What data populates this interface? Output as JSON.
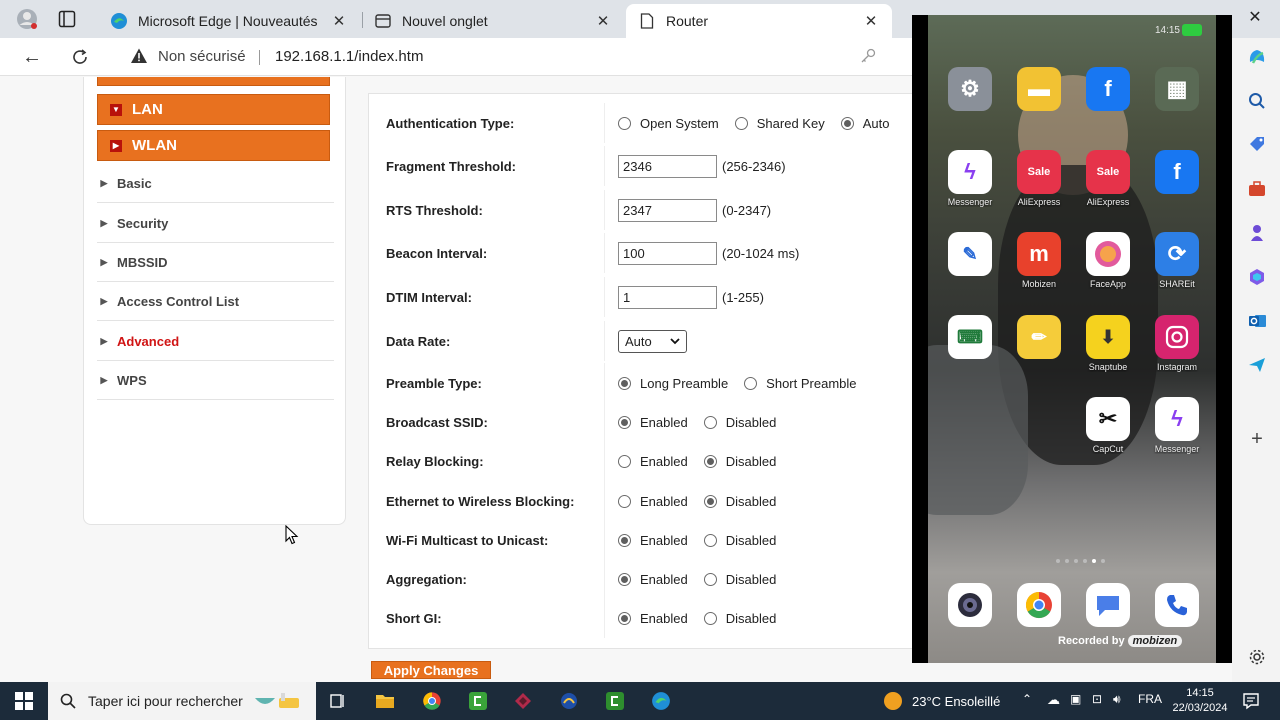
{
  "browser": {
    "tabs": [
      {
        "label": "Microsoft Edge | Nouveautés",
        "active": false
      },
      {
        "label": "Nouvel onglet",
        "active": false
      },
      {
        "label": "Router",
        "active": true
      }
    ],
    "address": {
      "security_label": "Non sécurisé",
      "url": "192.168.1.1/index.htm"
    }
  },
  "router": {
    "menu": {
      "lan_label": "LAN",
      "wlan_label": "WLAN",
      "sub_items": [
        "Basic",
        "Security",
        "MBSSID",
        "Access Control List",
        "Advanced",
        "WPS"
      ],
      "active_item": "Advanced"
    },
    "settings": {
      "auth_type": {
        "label": "Authentication Type:",
        "options": [
          "Open System",
          "Shared Key",
          "Auto"
        ],
        "selected": "Auto"
      },
      "fragment_threshold": {
        "label": "Fragment Threshold:",
        "value": "2346",
        "range": "(256-2346)"
      },
      "rts_threshold": {
        "label": "RTS Threshold:",
        "value": "2347",
        "range": "(0-2347)"
      },
      "beacon_interval": {
        "label": "Beacon Interval:",
        "value": "100",
        "range": "(20-1024 ms)"
      },
      "dtim_interval": {
        "label": "DTIM Interval:",
        "value": "1",
        "range": "(1-255)"
      },
      "data_rate": {
        "label": "Data Rate:",
        "value": "Auto"
      },
      "preamble_type": {
        "label": "Preamble Type:",
        "options": [
          "Long Preamble",
          "Short Preamble"
        ],
        "selected": "Long Preamble"
      },
      "broadcast_ssid": {
        "label": "Broadcast SSID:",
        "selected": "Enabled"
      },
      "relay_blocking": {
        "label": "Relay Blocking:",
        "selected": "Disabled"
      },
      "ethernet_to_wireless": {
        "label": "Ethernet to Wireless Blocking:",
        "selected": "Disabled"
      },
      "wifi_multicast": {
        "label": "Wi-Fi Multicast to Unicast:",
        "selected": "Enabled"
      },
      "aggregation": {
        "label": "Aggregation:",
        "selected": "Enabled"
      },
      "short_gi": {
        "label": "Short GI:",
        "selected": "Enabled"
      },
      "enabled_label": "Enabled",
      "disabled_label": "Disabled"
    },
    "apply_label": "Apply Changes"
  },
  "phone": {
    "status_time": "14:15",
    "apps": [
      {
        "name": "",
        "icon": "settings-icon",
        "color": "#8a9099"
      },
      {
        "name": "",
        "icon": "folder-icon",
        "color": "#f2c233"
      },
      {
        "name": "",
        "icon": "facebook-icon",
        "color": "#1877f2"
      },
      {
        "name": "",
        "icon": "apps-icon",
        "color": "#5a6a55"
      },
      {
        "name": "Messenger",
        "icon": "messenger-icon",
        "color": "#ffffff"
      },
      {
        "name": "AliExpress",
        "icon": "aliexpress-icon",
        "color": "#e6334a"
      },
      {
        "name": "AliExpress",
        "icon": "aliexpress-icon",
        "color": "#e6334a"
      },
      {
        "name": "",
        "icon": "facebook-icon",
        "color": "#1877f2"
      },
      {
        "name": "",
        "icon": "note-icon",
        "color": "#ffffff"
      },
      {
        "name": "Mobizen",
        "icon": "mobizen-icon",
        "color": "#e8412c"
      },
      {
        "name": "FaceApp",
        "icon": "faceapp-icon",
        "color": "#ffffff"
      },
      {
        "name": "SHAREit",
        "icon": "shareit-icon",
        "color": "#2d7fe6"
      },
      {
        "name": "",
        "icon": "keyboard-icon",
        "color": "#ffffff"
      },
      {
        "name": "",
        "icon": "pencil-icon",
        "color": "#f5cc3a"
      },
      {
        "name": "Snaptube",
        "icon": "snaptube-icon",
        "color": "#f5d21e"
      },
      {
        "name": "Instagram",
        "icon": "instagram-icon",
        "color": "#d6246e"
      },
      {
        "name": "CapCut",
        "icon": "capcut-icon",
        "color": "#ffffff"
      },
      {
        "name": "Messenger",
        "icon": "messenger-icon",
        "color": "#ffffff"
      }
    ],
    "dock": [
      "camera-icon",
      "chrome-icon",
      "messages-icon",
      "phone-icon"
    ],
    "recorded_label": "Recorded by",
    "recorded_brand": "mobizen"
  },
  "taskbar": {
    "search_placeholder": "Taper ici pour rechercher",
    "weather": "23°C  Ensoleillé",
    "language": "FRA",
    "time": "14:15",
    "date": "22/03/2024"
  }
}
